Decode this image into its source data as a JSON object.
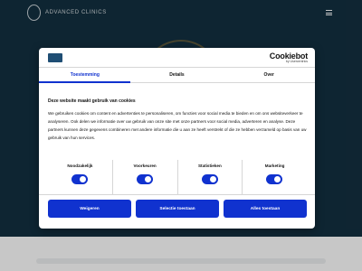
{
  "site": {
    "logo_text": "ADVANCED CLINICS",
    "logo_icon": "monogram-icon",
    "menu_icon": "hamburger-icon"
  },
  "cookie_dialog": {
    "brand_name": "Cookiebot",
    "brand_sub": "by Usercentrics",
    "tabs": [
      {
        "label": "Toestemming",
        "active": true
      },
      {
        "label": "Details",
        "active": false
      },
      {
        "label": "Over",
        "active": false
      }
    ],
    "title": "Deze website maakt gebruik van cookies",
    "body": "We gebruiken cookies om content en advertenties te personaliseren, om functies voor social media te bieden en om ons websiteverkeer te analyseren. Ook delen we informatie over uw gebruik van onze site met onze partners voor social media, adverteren en analyse. Deze partners kunnen deze gegevens combineren met andere informatie die u aan ze heeft verstrekt of die ze hebben verzameld op basis van uw gebruik van hun services.",
    "preferences": [
      {
        "label": "Noodzakelijk",
        "enabled": true
      },
      {
        "label": "Voorkeuren",
        "enabled": true
      },
      {
        "label": "Statistieken",
        "enabled": true
      },
      {
        "label": "Marketing",
        "enabled": true
      }
    ],
    "buttons": {
      "deny": "Weigeren",
      "allow_selection": "Selectie toestaan",
      "allow_all": "Alles toestaan"
    }
  },
  "colors": {
    "header_bg": "#133040",
    "accent": "#1032cf",
    "text": "#141414"
  }
}
